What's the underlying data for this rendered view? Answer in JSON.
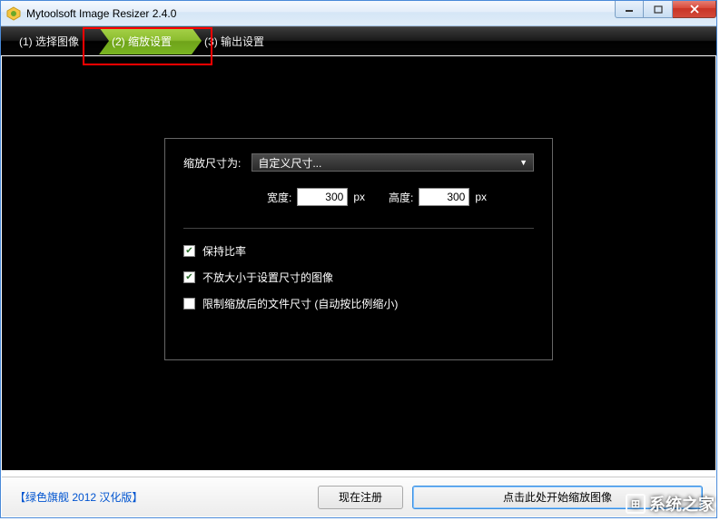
{
  "window": {
    "title": "Mytoolsoft Image Resizer 2.4.0"
  },
  "breadcrumb": {
    "step1": "(1) 选择图像",
    "step2": "(2) 缩放设置",
    "step3": "(3) 输出设置",
    "active_index": 1
  },
  "panel": {
    "scale_label": "缩放尺寸为:",
    "dropdown_selected": "自定义尺寸...",
    "width_label": "宽度:",
    "width_value": "300",
    "width_unit": "px",
    "height_label": "高度:",
    "height_value": "300",
    "height_unit": "px",
    "checkbox1": {
      "checked": true,
      "label": "保持比率"
    },
    "checkbox2": {
      "checked": true,
      "label": "不放大小于设置尺寸的图像"
    },
    "checkbox3": {
      "checked": false,
      "label": "限制缩放后的文件尺寸 (自动按比例缩小)"
    }
  },
  "footer": {
    "brand": "绿色旗舰 2012 汉化版",
    "register_button": "现在注册",
    "start_button": "点击此处开始缩放图像"
  },
  "watermark": {
    "text": "系统之家"
  }
}
